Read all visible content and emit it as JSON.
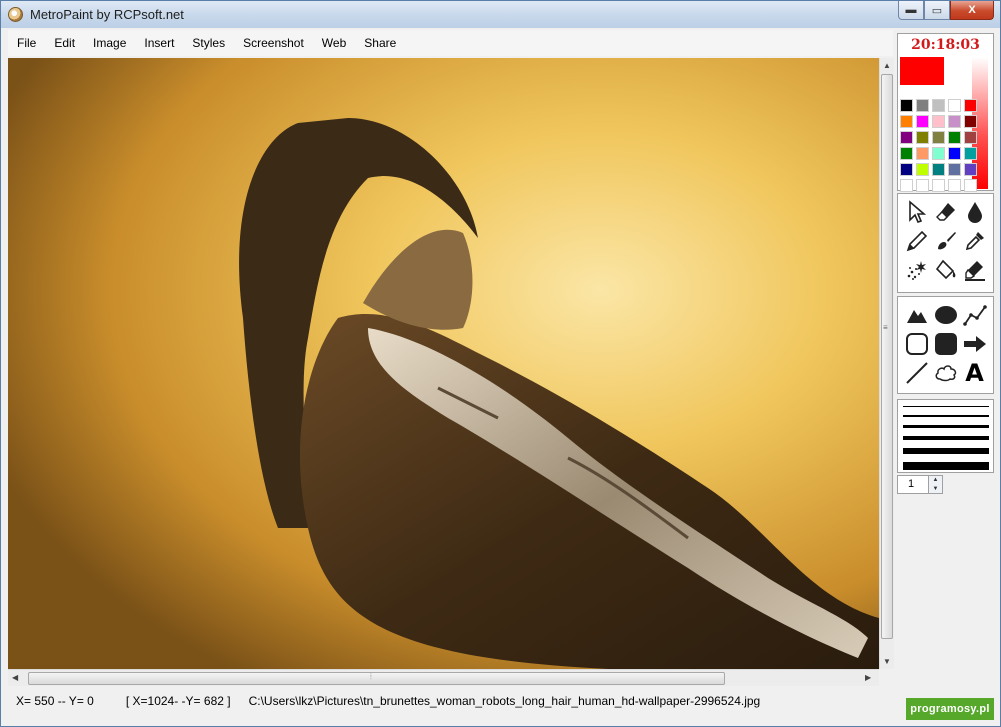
{
  "window": {
    "title": "MetroPaint by RCPsoft.net",
    "minimize": "▬",
    "maximize": "▭",
    "close": "X"
  },
  "menu": [
    "File",
    "Edit",
    "Image",
    "Insert",
    "Styles",
    "Screenshot",
    "Web",
    "Share"
  ],
  "canvas": {
    "image_icon": "photo-woman-robotic-arm"
  },
  "status": {
    "cursor": "X= 550 --  Y= 0",
    "size": "[ X=1024- -Y= 682 ]",
    "path": "C:\\Users\\lkz\\Pictures\\tn_brunettes_woman_robots_long_hair_human_hd-wallpaper-2996524.jpg"
  },
  "panel": {
    "clock": "20:18:03",
    "primary_color": "#ff0000",
    "secondary_color": "#ffffff",
    "palette": [
      "#000000",
      "#808080",
      "#c0c0c0",
      "#ffffff",
      "#ff0000",
      "#ff8000",
      "#ff00ff",
      "#ffc0cb",
      "#c890c8",
      "#800000",
      "#800080",
      "#808000",
      "#808040",
      "#008000",
      "#a04040",
      "#008000",
      "#ff9966",
      "#80ffd0",
      "#0000ff",
      "#00a0a0",
      "#000080",
      "#c0ff00",
      "#008080",
      "#6070a0",
      "#6040c0",
      "#ffffff",
      "#ffffff",
      "#ffffff",
      "#ffffff",
      "#ffffff"
    ],
    "tools": [
      "pointer-icon",
      "eraser-icon",
      "drop-icon",
      "pencil-icon",
      "brush-icon",
      "color-picker-icon",
      "airbrush-icon",
      "fill-bucket-icon",
      "highlighter-icon"
    ],
    "shapes": [
      "triangle-icon",
      "ellipse-icon",
      "polyline-icon",
      "rounded-rect-icon",
      "filled-rect-icon",
      "arrow-icon",
      "line-icon",
      "cloud-icon",
      "text-icon"
    ],
    "text_tool_label": "A",
    "line_widths": [
      1,
      2,
      3,
      4,
      6,
      8
    ],
    "width_value": "1"
  },
  "watermark": "programosy.pl"
}
